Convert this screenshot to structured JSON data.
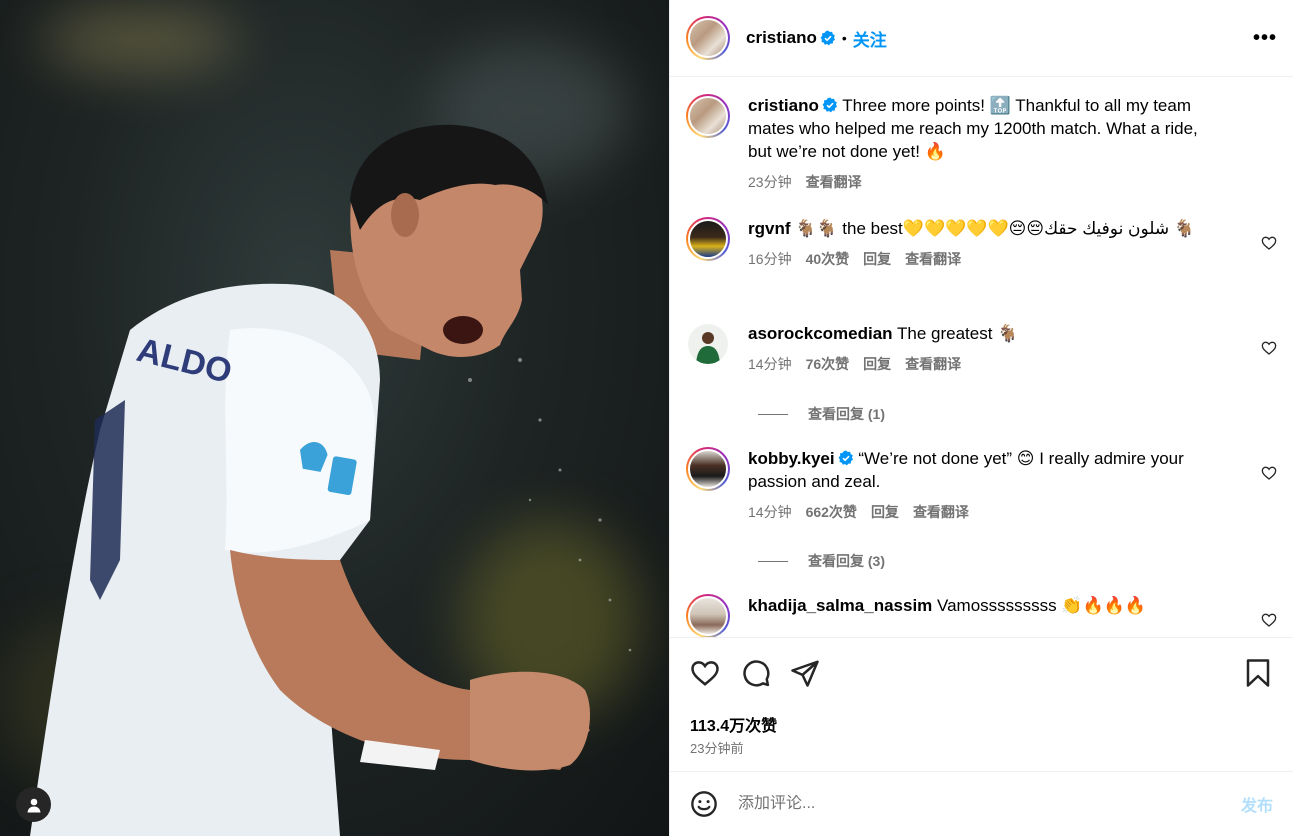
{
  "post": {
    "author": "cristiano",
    "follow_label": "关注",
    "dot": "•",
    "more_label": "•••",
    "caption": {
      "text": "Three more points! 🔝 Thankful to all my team mates who helped me reach my 1200th match. What a ride, but we’re not done yet! 🔥",
      "time": "23分钟",
      "translate": "查看翻译"
    },
    "comments": [
      {
        "user": "rgvnf",
        "text": "🐐🐐 the best💛💛💛💛💛😔😔شلون نوفيك حقك 🐐",
        "time": "16分钟",
        "likes": "40次赞",
        "reply": "回复",
        "translate": "查看翻译"
      },
      {
        "user": "asorockcomedian",
        "text": "The greatest 🐐",
        "time": "14分钟",
        "likes": "76次赞",
        "reply": "回复",
        "translate": "查看翻译",
        "view_replies": "查看回复 (1)"
      },
      {
        "user": "kobby.kyei",
        "text": "“We’re not done yet” 😊 I really admire your passion and zeal.",
        "time": "14分钟",
        "likes": "662次赞",
        "reply": "回复",
        "translate": "查看翻译",
        "view_replies": "查看回复 (3)"
      },
      {
        "user": "khadija_salma_nassim",
        "text": "Vamosssssssss 👏🔥🔥🔥"
      }
    ],
    "likes_total": "113.4万次赞",
    "posted_ago": "23分钟前",
    "add_comment_placeholder": "添加评论...",
    "post_button": "发布",
    "jersey_text": "ALDO"
  },
  "colors": {
    "accent": "#0095f6",
    "muted": "#737373",
    "verified": "#0095f6",
    "post_disabled": "#b2dffc"
  }
}
